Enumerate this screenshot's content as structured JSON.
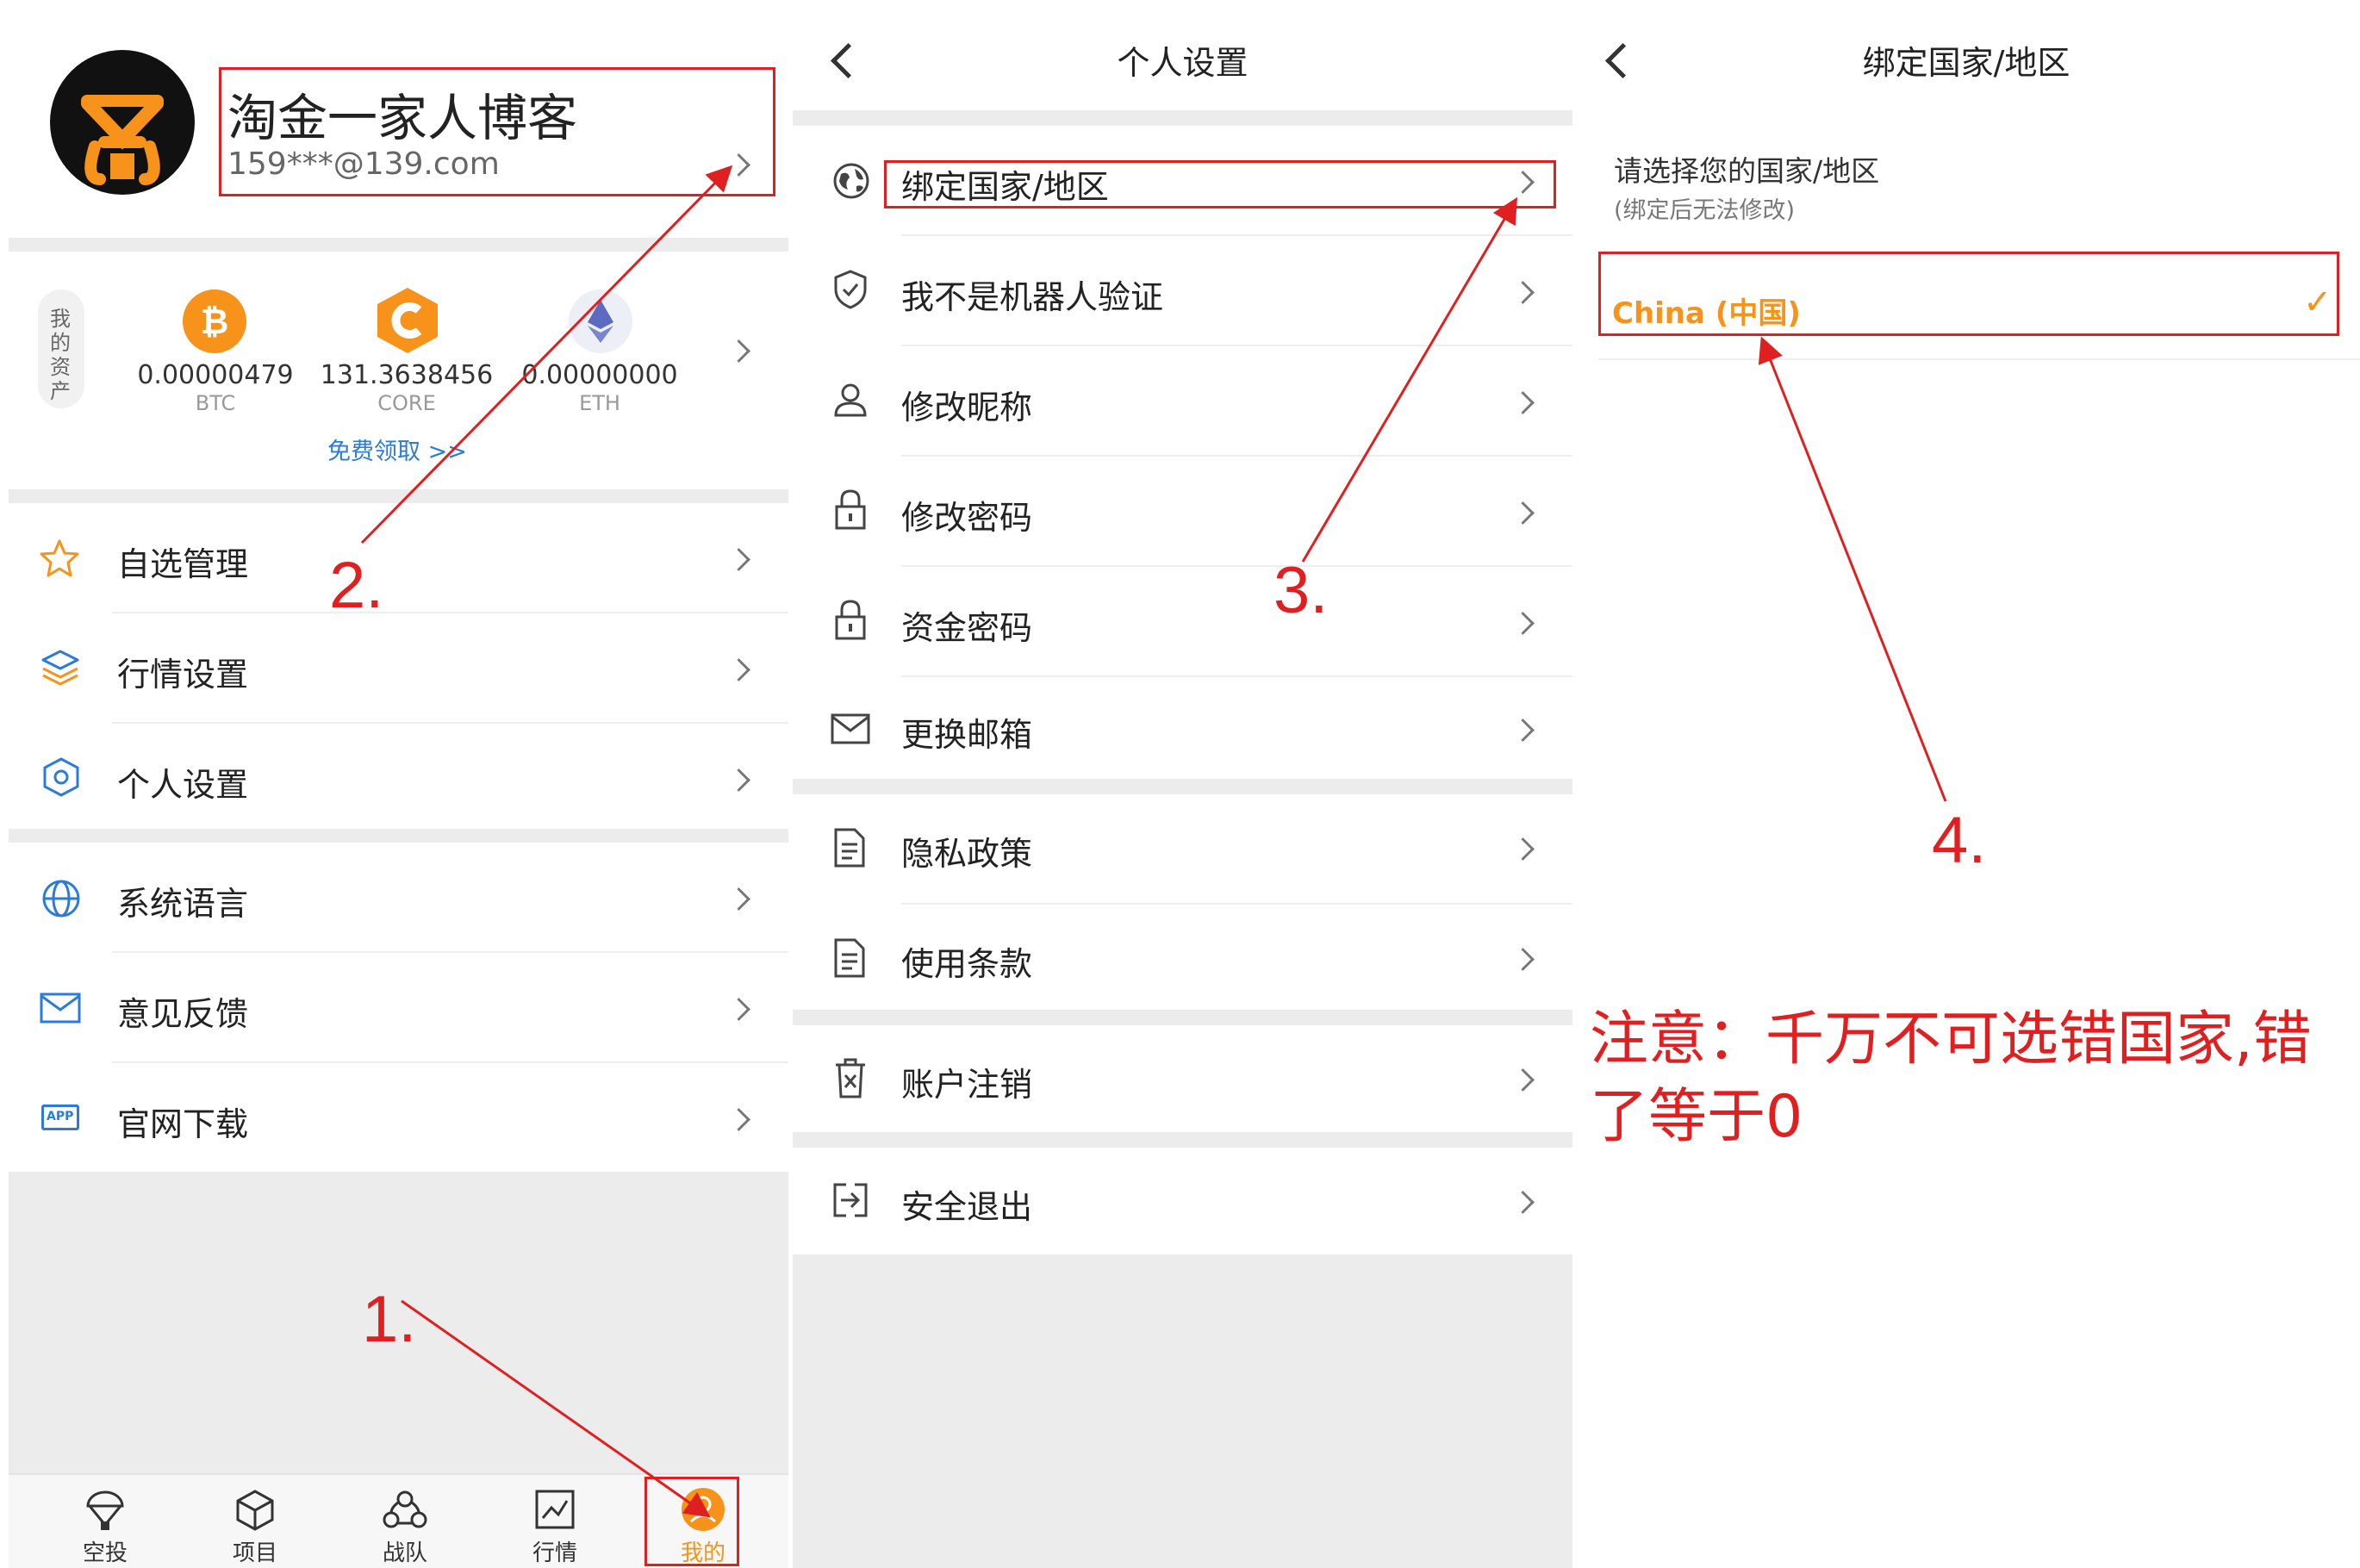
{
  "profile": {
    "name": "淘金一家人博客",
    "email": "159***@139.com"
  },
  "assets": {
    "label_chars": [
      "我",
      "的",
      "资",
      "产"
    ],
    "items": [
      {
        "value": "0.00000479",
        "symbol": "BTC"
      },
      {
        "value": "131.3638456",
        "symbol": "CORE"
      },
      {
        "value": "0.00000000",
        "symbol": "ETH"
      }
    ],
    "free_claim": "免费领取 >>"
  },
  "menu1": [
    "自选管理",
    "行情设置",
    "个人设置"
  ],
  "menu2": [
    "系统语言",
    "意见反馈",
    "官网下载"
  ],
  "app_badge": "APP",
  "bottom_nav": [
    "空投",
    "项目",
    "战队",
    "行情",
    "我的"
  ],
  "personal_settings": {
    "title": "个人设置",
    "group1": [
      "绑定国家/地区",
      "我不是机器人验证",
      "修改昵称",
      "修改密码",
      "资金密码",
      "更换邮箱"
    ],
    "group2": [
      "隐私政策",
      "使用条款"
    ],
    "group3": [
      "账户注销"
    ],
    "group4": [
      "安全退出"
    ]
  },
  "country": {
    "title": "绑定国家/地区",
    "prompt": "请选择您的国家/地区",
    "note": "(绑定后无法修改)",
    "selected": "China (中国)",
    "check": "✓"
  },
  "annotations": {
    "steps": [
      "1.",
      "2.",
      "3.",
      "4."
    ],
    "warning_line1": "注意：千万不可选错国家,错",
    "warning_line2": "了等于0"
  },
  "colors": {
    "accent_orange": "#f7931a",
    "annotation_red": "#e02020",
    "icon_blue": "#2b7bd8"
  }
}
